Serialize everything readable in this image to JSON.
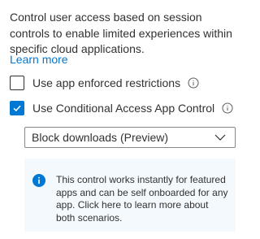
{
  "description": "Control user access based on session controls to enable limited experiences within specific cloud applications.",
  "learn_more": "Learn more",
  "options": [
    {
      "label": "Use app enforced restrictions",
      "checked": false
    },
    {
      "label": "Use Conditional Access App Control",
      "checked": true
    }
  ],
  "dropdown": {
    "selected": "Block downloads (Preview)"
  },
  "info_message": "This control works instantly for featured apps and can be self onboarded for any app. Click here to learn more about both scenarios.",
  "colors": {
    "accent": "#0078d4",
    "text": "#323130",
    "info_background": "#f3f9fd"
  }
}
